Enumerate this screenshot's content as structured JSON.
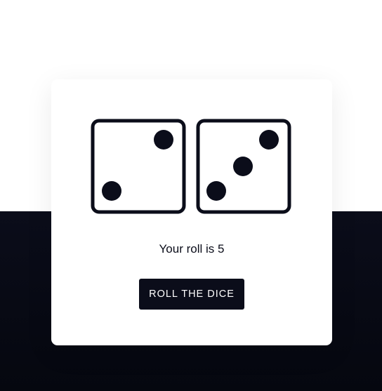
{
  "dice": [
    {
      "value": 2
    },
    {
      "value": 3
    }
  ],
  "result": {
    "prefix": "Your roll is",
    "total": "5"
  },
  "roll_button_label": "ROLL THE DICE",
  "colors": {
    "dark": "#0b0d1a",
    "card": "#ffffff",
    "page_top": "#ffffff"
  }
}
